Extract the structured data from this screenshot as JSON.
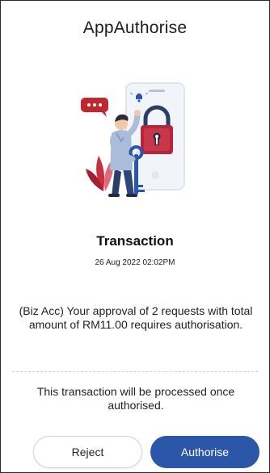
{
  "header": {
    "title": "AppAuthorise"
  },
  "illustration": {
    "icon": "padlock-phone-illustration"
  },
  "transaction": {
    "title": "Transaction",
    "datetime": "26 Aug 2022 02:02PM",
    "message": "(Biz Acc) Your approval of 2 requests with total amount of RM11.00 requires authorisation.",
    "note": "This transaction will be processed once authorised."
  },
  "actions": {
    "reject_label": "Reject",
    "authorise_label": "Authorise"
  },
  "colors": {
    "accent": "#2c57a8",
    "lock": "#b5263a",
    "bubble": "#c2272d"
  }
}
